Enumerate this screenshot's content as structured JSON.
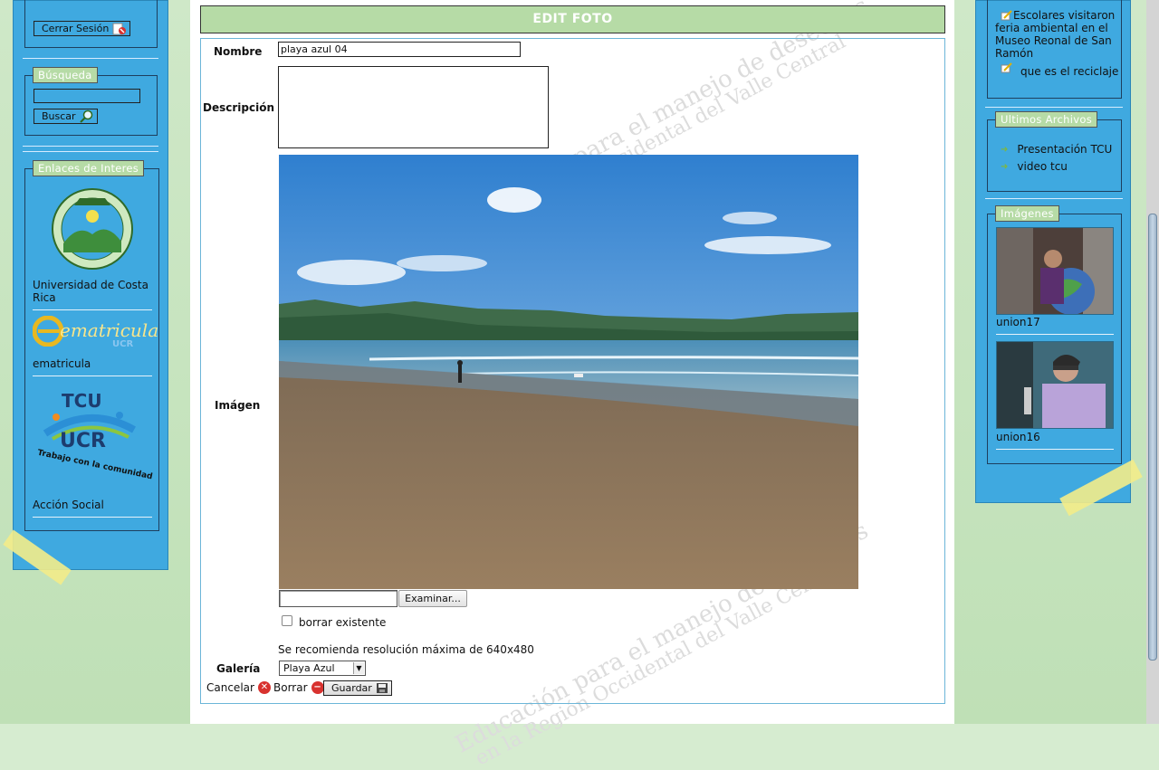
{
  "left_sidebar": {
    "logout_label": "Cerrar Sesión",
    "search_legend": "Búsqueda",
    "search_value": "",
    "search_button": "Buscar",
    "links_legend": "Enlaces de Interes",
    "links": [
      {
        "label": "Universidad de Costa Rica",
        "logo": "ucr-seal-logo"
      },
      {
        "label": "ematricula",
        "logo": "ematricula-logo",
        "logo_text": "ematricula",
        "logo_sub": "UCR"
      },
      {
        "label": "Acción Social",
        "logo": "tcu-ucr-logo",
        "logo_top": "TCU",
        "logo_mid": "UCR",
        "logo_bottom": "Trabajo con la comunidad"
      }
    ]
  },
  "main": {
    "title": "EDIT FOTO",
    "watermark_line1": "Educación para el manejo de desechos",
    "watermark_line2": "en la Región Occidental del Valle Central",
    "fields": {
      "nombre_label": "Nombre",
      "nombre_value": "playa azul 04",
      "descripcion_label": "Descripción",
      "descripcion_value": "",
      "imagen_label": "Imágen",
      "file_button": "Examinar...",
      "borrar_existente_label": "borrar existente",
      "borrar_existente_checked": false,
      "resolution_note": "Se recomienda resolución máxima de 640x480",
      "galeria_label": "Galería",
      "galeria_selected": "Playa Azul"
    },
    "actions": {
      "cancel_label": "Cancelar",
      "delete_label": "Borrar",
      "save_label": "Guardar"
    }
  },
  "right_sidebar": {
    "news_items": [
      "Escolares visitaron feria ambiental en el Museo Reonal de San Ramón",
      "que es el reciclaje"
    ],
    "files_legend": "Ultimos Archivos",
    "files": [
      "Presentación TCU",
      "video tcu"
    ],
    "images_legend": "Imágenes",
    "images": [
      {
        "caption": "union17"
      },
      {
        "caption": "union16"
      }
    ]
  },
  "colors": {
    "sidebar_blue": "#3fa9e0",
    "legend_green": "#b6dba6",
    "page_green": "#d6ecd0",
    "tape_yellow": "#f3ec8a"
  }
}
